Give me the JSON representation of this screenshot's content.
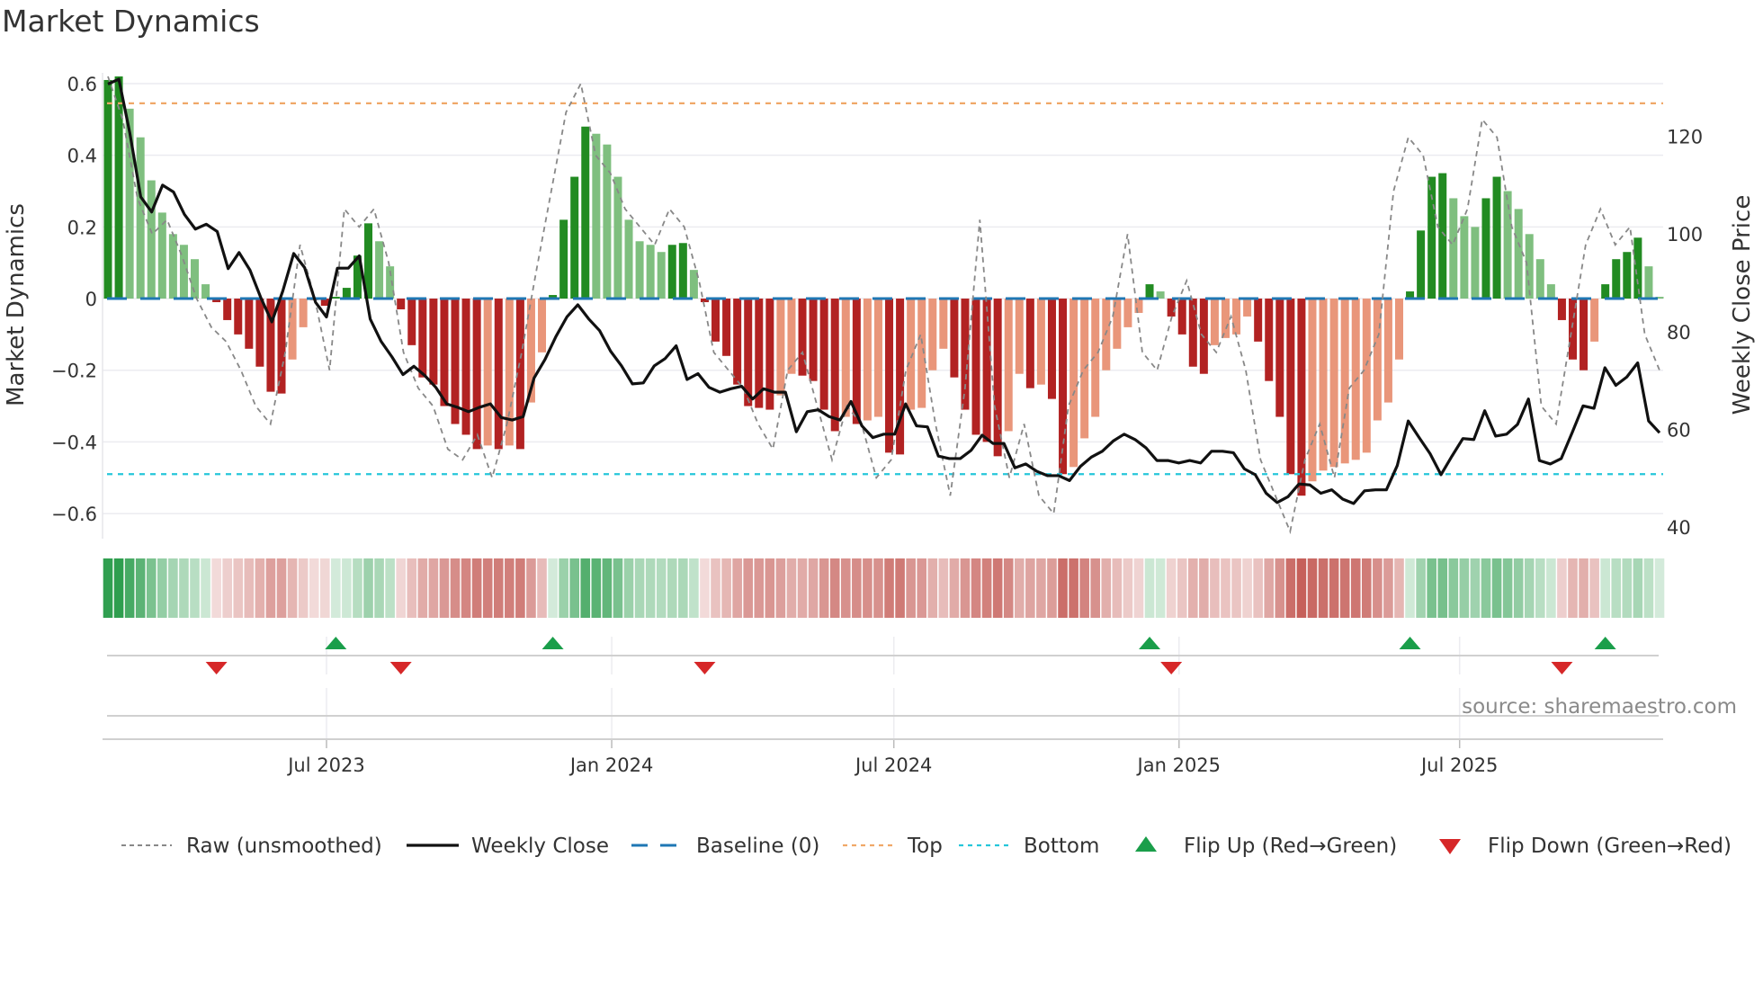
{
  "title": "Market Dynamics",
  "source": "source: sharemaestro.com",
  "colors": {
    "bar_up_strong": "#228b22",
    "bar_up_weak": "#7fbf7f",
    "bar_down_strong": "#b22222",
    "bar_down_weak": "#e9967a",
    "price": "#111111",
    "raw": "#888888",
    "baseline": "#1f77b4",
    "top": "#f0a868",
    "bottom": "#26c6da",
    "flip_up": "#1a9e4a",
    "flip_down": "#d62728",
    "strip_green": "#2e9e4e",
    "strip_red": "#c0504a"
  },
  "chart_data": {
    "type": "bar",
    "title": "Market Dynamics",
    "ylabel": "Market Dynamics",
    "y2label": "Weekly Close Price",
    "frequency": "weekly",
    "start_date": "2023-02-10",
    "ylim": [
      -0.67,
      0.63
    ],
    "y2lim": [
      37.6,
      133
    ],
    "yticks": [
      {
        "v": 0.6,
        "label": "0.6"
      },
      {
        "v": 0.4,
        "label": "0.4"
      },
      {
        "v": 0.2,
        "label": "0.2"
      },
      {
        "v": 0,
        "label": "0"
      },
      {
        "v": -0.2,
        "label": "−0.2"
      },
      {
        "v": -0.4,
        "label": "−0.4"
      },
      {
        "v": -0.6,
        "label": "−0.6"
      }
    ],
    "y2ticks": [
      {
        "v": 40,
        "label": "40"
      },
      {
        "v": 60,
        "label": "60"
      },
      {
        "v": 80,
        "label": "80"
      },
      {
        "v": 100,
        "label": "100"
      },
      {
        "v": 120,
        "label": "120"
      }
    ],
    "xticks": [
      {
        "date": "2023-07-01",
        "label": "Jul 2023"
      },
      {
        "date": "2024-01-01",
        "label": "Jan 2024"
      },
      {
        "date": "2024-07-01",
        "label": "Jul 2024"
      },
      {
        "date": "2025-01-01",
        "label": "Jan 2025"
      },
      {
        "date": "2025-07-01",
        "label": "Jul 2025"
      }
    ],
    "top_level": 0.545,
    "bottom_level": -0.49,
    "baseline": 0,
    "dynamics": [
      0.61,
      0.62,
      0.53,
      0.45,
      0.33,
      0.24,
      0.18,
      0.15,
      0.11,
      0.04,
      -0.01,
      -0.06,
      -0.1,
      -0.14,
      -0.19,
      -0.26,
      -0.265,
      -0.17,
      -0.08,
      -0.005,
      -0.02,
      0.005,
      0.03,
      0.12,
      0.21,
      0.16,
      0.09,
      -0.03,
      -0.13,
      -0.22,
      -0.24,
      -0.3,
      -0.35,
      -0.38,
      -0.42,
      -0.41,
      -0.42,
      -0.41,
      -0.42,
      -0.29,
      -0.15,
      0.01,
      0.22,
      0.34,
      0.48,
      0.46,
      0.43,
      0.34,
      0.22,
      0.16,
      0.15,
      0.13,
      0.15,
      0.155,
      0.08,
      -0.01,
      -0.12,
      -0.16,
      -0.24,
      -0.3,
      -0.305,
      -0.31,
      -0.27,
      -0.21,
      -0.215,
      -0.23,
      -0.31,
      -0.37,
      -0.33,
      -0.35,
      -0.34,
      -0.33,
      -0.43,
      -0.435,
      -0.31,
      -0.305,
      -0.2,
      -0.14,
      -0.22,
      -0.31,
      -0.38,
      -0.4,
      -0.44,
      -0.37,
      -0.21,
      -0.25,
      -0.24,
      -0.28,
      -0.49,
      -0.47,
      -0.39,
      -0.33,
      -0.2,
      -0.14,
      -0.08,
      -0.04,
      0.04,
      0.02,
      -0.05,
      -0.1,
      -0.19,
      -0.21,
      -0.13,
      -0.11,
      -0.1,
      -0.05,
      -0.12,
      -0.23,
      -0.33,
      -0.49,
      -0.55,
      -0.51,
      -0.48,
      -0.47,
      -0.46,
      -0.45,
      -0.43,
      -0.34,
      -0.29,
      -0.17,
      0.02,
      0.19,
      0.34,
      0.35,
      0.28,
      0.23,
      0.2,
      0.28,
      0.34,
      0.3,
      0.25,
      0.18,
      0.11,
      0.04,
      -0.06,
      -0.17,
      -0.2,
      -0.12,
      0.04,
      0.11,
      0.13,
      0.17,
      0.09,
      0.005
    ],
    "raw": [
      0.62,
      0.5,
      0.28,
      0.18,
      0.22,
      0.12,
      0.0,
      -0.08,
      -0.12,
      -0.2,
      -0.3,
      -0.35,
      -0.15,
      0.15,
      0.0,
      -0.2,
      0.25,
      0.2,
      0.25,
      0.1,
      -0.15,
      -0.25,
      -0.3,
      -0.42,
      -0.45,
      -0.38,
      -0.5,
      -0.35,
      -0.15,
      0.08,
      0.3,
      0.52,
      0.6,
      0.4,
      0.35,
      0.25,
      0.2,
      0.15,
      0.25,
      0.2,
      0.05,
      -0.15,
      -0.2,
      -0.25,
      -0.35,
      -0.42,
      -0.2,
      -0.15,
      -0.3,
      -0.45,
      -0.3,
      -0.35,
      -0.5,
      -0.45,
      -0.2,
      -0.1,
      -0.35,
      -0.55,
      -0.25,
      0.22,
      -0.3,
      -0.5,
      -0.35,
      -0.55,
      -0.6,
      -0.3,
      -0.2,
      -0.15,
      -0.05,
      0.18,
      -0.15,
      -0.2,
      -0.05,
      0.05,
      -0.1,
      -0.15,
      -0.05,
      -0.2,
      -0.45,
      -0.55,
      -0.65,
      -0.45,
      -0.35,
      -0.5,
      -0.25,
      -0.2,
      -0.1,
      0.3,
      0.45,
      0.4,
      0.2,
      0.15,
      0.25,
      0.5,
      0.45,
      0.2,
      0.1,
      -0.3,
      -0.35,
      -0.1,
      0.15,
      0.25,
      0.15,
      0.2,
      -0.1,
      -0.2
    ],
    "weekly_close": [
      130.7,
      131.7,
      120.7,
      107.6,
      104.5,
      110,
      108.6,
      104,
      101,
      102,
      100.5,
      92.9,
      96.2,
      92.6,
      86.9,
      82,
      88.3,
      96,
      93.1,
      86,
      83,
      93,
      93,
      95.5,
      82.6,
      78,
      74.8,
      71.2,
      72.9,
      71,
      68.6,
      65.2,
      64.5,
      63.6,
      64.5,
      65.2,
      62.4,
      61.9,
      62.6,
      70.5,
      74.3,
      79,
      83,
      85.5,
      82.6,
      80.2,
      76,
      73,
      69.3,
      69.5,
      73,
      74.5,
      77.1,
      70.2,
      71.4,
      68.6,
      67.6,
      68.3,
      68.8,
      66.2,
      68.3,
      67.6,
      67.6,
      59.5,
      63.6,
      64,
      62.6,
      61.9,
      65.7,
      60.7,
      58.3,
      59,
      59,
      65.2,
      60.7,
      60.5,
      54.5,
      54,
      54,
      55.7,
      58.8,
      57.1,
      57.1,
      52.1,
      52.9,
      51.4,
      50.5,
      50.5,
      49.5,
      52.4,
      54.3,
      55.5,
      57.6,
      59,
      57.9,
      56.2,
      53.6,
      53.6,
      53.1,
      53.6,
      53.1,
      55.5,
      55.5,
      55.2,
      51.9,
      50.7,
      46.9,
      45,
      46.2,
      48.8,
      48.6,
      46.9,
      47.6,
      45.7,
      44.8,
      47.4,
      47.6,
      47.6,
      52.6,
      61.7,
      58.3,
      55,
      50.7,
      54.5,
      58.1,
      57.9,
      63.8,
      58.6,
      59,
      61,
      66.2,
      53.6,
      52.9,
      54,
      59.3,
      64.8,
      64.3,
      72.6,
      69,
      70.7,
      73.6,
      61.7,
      59.3
    ],
    "flip_up_dates": [
      "2023-07-07",
      "2023-11-24",
      "2024-12-13",
      "2025-05-30",
      "2025-10-03"
    ],
    "flip_down_dates": [
      "2023-04-21",
      "2023-08-18",
      "2024-03-01",
      "2024-12-27",
      "2025-09-05"
    ],
    "legend": [
      {
        "key": "raw",
        "label": "Raw (unsmoothed)"
      },
      {
        "key": "price",
        "label": "Weekly Close"
      },
      {
        "key": "baseline",
        "label": "Baseline (0)"
      },
      {
        "key": "top",
        "label": "Top"
      },
      {
        "key": "bottom",
        "label": "Bottom"
      },
      {
        "key": "flip_up",
        "label": "Flip Up (Red→Green)"
      },
      {
        "key": "flip_down",
        "label": "Flip Down (Green→Red)"
      }
    ],
    "legend_position": "bottom"
  }
}
